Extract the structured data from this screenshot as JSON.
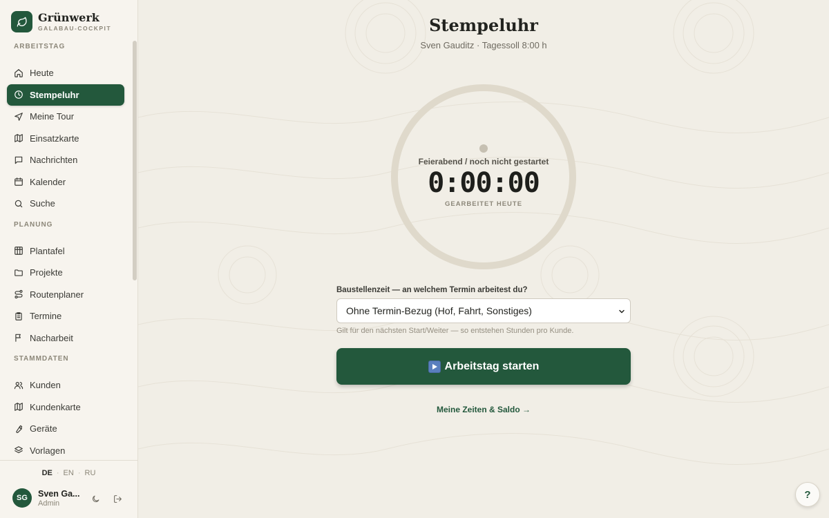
{
  "brand": {
    "name": "Grünwerk",
    "subtitle": "GALABAU-COCKPIT",
    "logo_icon": "leaf-icon"
  },
  "sidebar": {
    "sections": [
      {
        "title": "ARBEITSTAG",
        "items": [
          {
            "label": "Heute",
            "icon": "home-icon"
          },
          {
            "label": "Stempeluhr",
            "icon": "clock-icon",
            "active": true
          },
          {
            "label": "Meine Tour",
            "icon": "navigation-icon"
          },
          {
            "label": "Einsatzkarte",
            "icon": "map-icon"
          },
          {
            "label": "Nachrichten",
            "icon": "message-icon"
          },
          {
            "label": "Kalender",
            "icon": "calendar-icon"
          },
          {
            "label": "Suche",
            "icon": "search-icon"
          }
        ]
      },
      {
        "title": "PLANUNG",
        "items": [
          {
            "label": "Plantafel",
            "icon": "grid-icon"
          },
          {
            "label": "Projekte",
            "icon": "folder-icon"
          },
          {
            "label": "Routenplaner",
            "icon": "route-icon"
          },
          {
            "label": "Termine",
            "icon": "clipboard-icon"
          },
          {
            "label": "Nacharbeit",
            "icon": "flag-icon"
          }
        ]
      },
      {
        "title": "STAMMDATEN",
        "items": [
          {
            "label": "Kunden",
            "icon": "users-icon"
          },
          {
            "label": "Kundenkarte",
            "icon": "map-icon"
          },
          {
            "label": "Geräte",
            "icon": "tool-icon"
          },
          {
            "label": "Vorlagen",
            "icon": "layers-icon"
          }
        ]
      }
    ],
    "languages": [
      "DE",
      "EN",
      "RU"
    ],
    "current_language": "DE",
    "user": {
      "initials": "SG",
      "name": "Sven Ga...",
      "role": "Admin"
    }
  },
  "main": {
    "title": "Stempeluhr",
    "subtitle": "Sven Gauditz · Tagessoll 8:00 h",
    "clock": {
      "status": "Feierabend / noch nicht gestartet",
      "time": "0:00:00",
      "caption": "GEARBEITET HEUTE",
      "progress": 0
    },
    "assignment": {
      "label": "Baustellenzeit — an welchem Termin arbeitest du?",
      "selected": "Ohne Termin-Bezug (Hof, Fahrt, Sonstiges)",
      "hint": "Gilt für den nächsten Start/Weiter — so entstehen Stunden pro Kunde."
    },
    "start_button": "Arbeitstag starten",
    "times_link": "Meine Zeiten & Saldo →",
    "help_label": "?"
  },
  "colors": {
    "accent": "#23583c",
    "background": "#f1eee6",
    "sidebar": "#f7f4ee",
    "ring": "#dfd9cb"
  }
}
